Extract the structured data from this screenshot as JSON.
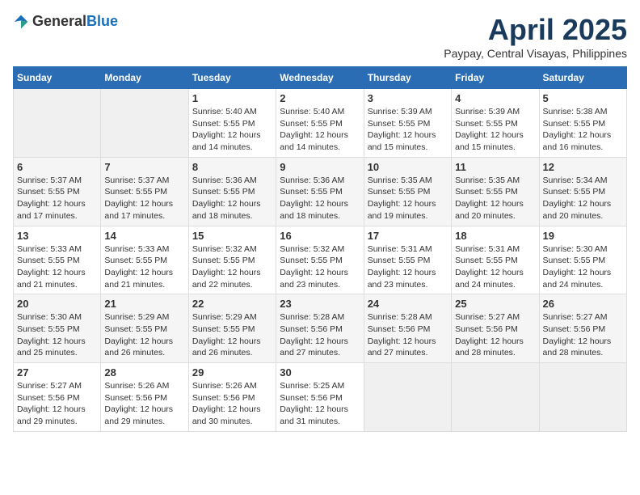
{
  "header": {
    "logo_general": "General",
    "logo_blue": "Blue",
    "title": "April 2025",
    "subtitle": "Paypay, Central Visayas, Philippines"
  },
  "calendar": {
    "days_of_week": [
      "Sunday",
      "Monday",
      "Tuesday",
      "Wednesday",
      "Thursday",
      "Friday",
      "Saturday"
    ],
    "weeks": [
      [
        {
          "day": "",
          "sunrise": "",
          "sunset": "",
          "daylight": ""
        },
        {
          "day": "",
          "sunrise": "",
          "sunset": "",
          "daylight": ""
        },
        {
          "day": "1",
          "sunrise": "Sunrise: 5:40 AM",
          "sunset": "Sunset: 5:55 PM",
          "daylight": "Daylight: 12 hours and 14 minutes."
        },
        {
          "day": "2",
          "sunrise": "Sunrise: 5:40 AM",
          "sunset": "Sunset: 5:55 PM",
          "daylight": "Daylight: 12 hours and 14 minutes."
        },
        {
          "day": "3",
          "sunrise": "Sunrise: 5:39 AM",
          "sunset": "Sunset: 5:55 PM",
          "daylight": "Daylight: 12 hours and 15 minutes."
        },
        {
          "day": "4",
          "sunrise": "Sunrise: 5:39 AM",
          "sunset": "Sunset: 5:55 PM",
          "daylight": "Daylight: 12 hours and 15 minutes."
        },
        {
          "day": "5",
          "sunrise": "Sunrise: 5:38 AM",
          "sunset": "Sunset: 5:55 PM",
          "daylight": "Daylight: 12 hours and 16 minutes."
        }
      ],
      [
        {
          "day": "6",
          "sunrise": "Sunrise: 5:37 AM",
          "sunset": "Sunset: 5:55 PM",
          "daylight": "Daylight: 12 hours and 17 minutes."
        },
        {
          "day": "7",
          "sunrise": "Sunrise: 5:37 AM",
          "sunset": "Sunset: 5:55 PM",
          "daylight": "Daylight: 12 hours and 17 minutes."
        },
        {
          "day": "8",
          "sunrise": "Sunrise: 5:36 AM",
          "sunset": "Sunset: 5:55 PM",
          "daylight": "Daylight: 12 hours and 18 minutes."
        },
        {
          "day": "9",
          "sunrise": "Sunrise: 5:36 AM",
          "sunset": "Sunset: 5:55 PM",
          "daylight": "Daylight: 12 hours and 18 minutes."
        },
        {
          "day": "10",
          "sunrise": "Sunrise: 5:35 AM",
          "sunset": "Sunset: 5:55 PM",
          "daylight": "Daylight: 12 hours and 19 minutes."
        },
        {
          "day": "11",
          "sunrise": "Sunrise: 5:35 AM",
          "sunset": "Sunset: 5:55 PM",
          "daylight": "Daylight: 12 hours and 20 minutes."
        },
        {
          "day": "12",
          "sunrise": "Sunrise: 5:34 AM",
          "sunset": "Sunset: 5:55 PM",
          "daylight": "Daylight: 12 hours and 20 minutes."
        }
      ],
      [
        {
          "day": "13",
          "sunrise": "Sunrise: 5:33 AM",
          "sunset": "Sunset: 5:55 PM",
          "daylight": "Daylight: 12 hours and 21 minutes."
        },
        {
          "day": "14",
          "sunrise": "Sunrise: 5:33 AM",
          "sunset": "Sunset: 5:55 PM",
          "daylight": "Daylight: 12 hours and 21 minutes."
        },
        {
          "day": "15",
          "sunrise": "Sunrise: 5:32 AM",
          "sunset": "Sunset: 5:55 PM",
          "daylight": "Daylight: 12 hours and 22 minutes."
        },
        {
          "day": "16",
          "sunrise": "Sunrise: 5:32 AM",
          "sunset": "Sunset: 5:55 PM",
          "daylight": "Daylight: 12 hours and 23 minutes."
        },
        {
          "day": "17",
          "sunrise": "Sunrise: 5:31 AM",
          "sunset": "Sunset: 5:55 PM",
          "daylight": "Daylight: 12 hours and 23 minutes."
        },
        {
          "day": "18",
          "sunrise": "Sunrise: 5:31 AM",
          "sunset": "Sunset: 5:55 PM",
          "daylight": "Daylight: 12 hours and 24 minutes."
        },
        {
          "day": "19",
          "sunrise": "Sunrise: 5:30 AM",
          "sunset": "Sunset: 5:55 PM",
          "daylight": "Daylight: 12 hours and 24 minutes."
        }
      ],
      [
        {
          "day": "20",
          "sunrise": "Sunrise: 5:30 AM",
          "sunset": "Sunset: 5:55 PM",
          "daylight": "Daylight: 12 hours and 25 minutes."
        },
        {
          "day": "21",
          "sunrise": "Sunrise: 5:29 AM",
          "sunset": "Sunset: 5:55 PM",
          "daylight": "Daylight: 12 hours and 26 minutes."
        },
        {
          "day": "22",
          "sunrise": "Sunrise: 5:29 AM",
          "sunset": "Sunset: 5:55 PM",
          "daylight": "Daylight: 12 hours and 26 minutes."
        },
        {
          "day": "23",
          "sunrise": "Sunrise: 5:28 AM",
          "sunset": "Sunset: 5:56 PM",
          "daylight": "Daylight: 12 hours and 27 minutes."
        },
        {
          "day": "24",
          "sunrise": "Sunrise: 5:28 AM",
          "sunset": "Sunset: 5:56 PM",
          "daylight": "Daylight: 12 hours and 27 minutes."
        },
        {
          "day": "25",
          "sunrise": "Sunrise: 5:27 AM",
          "sunset": "Sunset: 5:56 PM",
          "daylight": "Daylight: 12 hours and 28 minutes."
        },
        {
          "day": "26",
          "sunrise": "Sunrise: 5:27 AM",
          "sunset": "Sunset: 5:56 PM",
          "daylight": "Daylight: 12 hours and 28 minutes."
        }
      ],
      [
        {
          "day": "27",
          "sunrise": "Sunrise: 5:27 AM",
          "sunset": "Sunset: 5:56 PM",
          "daylight": "Daylight: 12 hours and 29 minutes."
        },
        {
          "day": "28",
          "sunrise": "Sunrise: 5:26 AM",
          "sunset": "Sunset: 5:56 PM",
          "daylight": "Daylight: 12 hours and 29 minutes."
        },
        {
          "day": "29",
          "sunrise": "Sunrise: 5:26 AM",
          "sunset": "Sunset: 5:56 PM",
          "daylight": "Daylight: 12 hours and 30 minutes."
        },
        {
          "day": "30",
          "sunrise": "Sunrise: 5:25 AM",
          "sunset": "Sunset: 5:56 PM",
          "daylight": "Daylight: 12 hours and 31 minutes."
        },
        {
          "day": "",
          "sunrise": "",
          "sunset": "",
          "daylight": ""
        },
        {
          "day": "",
          "sunrise": "",
          "sunset": "",
          "daylight": ""
        },
        {
          "day": "",
          "sunrise": "",
          "sunset": "",
          "daylight": ""
        }
      ]
    ]
  }
}
